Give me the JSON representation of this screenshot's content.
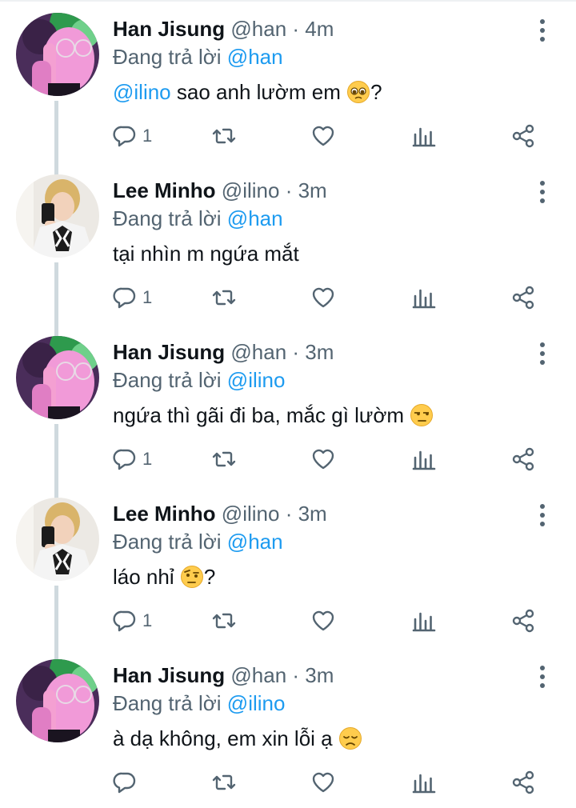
{
  "colors": {
    "accent": "#1d9bf0",
    "secondary_text": "#536471",
    "primary_text": "#0f1419",
    "thread_line": "#cfd9de"
  },
  "tweets": [
    {
      "name": "Han Jisung",
      "handle": "@han",
      "time": "· 4m",
      "replying_prefix": "Đang trả lời",
      "replying_to": "@han",
      "mention": "@ilino",
      "text": " sao anh lườm em ",
      "emoji": "pleading-face",
      "suffix": "?",
      "reply_count": "1",
      "avatar": "han-avatar"
    },
    {
      "name": "Lee Minho",
      "handle": "@ilino",
      "time": "· 3m",
      "replying_prefix": "Đang trả lời",
      "replying_to": "@han",
      "mention": "",
      "text": "tại nhìn m ngứa mắt",
      "emoji": "",
      "suffix": "",
      "reply_count": "1",
      "avatar": "minho-avatar"
    },
    {
      "name": "Han Jisung",
      "handle": "@han",
      "time": "· 3m",
      "replying_prefix": "Đang trả lời",
      "replying_to": "@ilino",
      "mention": "",
      "text": "ngứa thì gãi đi ba, mắc gì lườm ",
      "emoji": "unamused-face",
      "suffix": "",
      "reply_count": "1",
      "avatar": "han-avatar"
    },
    {
      "name": "Lee Minho",
      "handle": "@ilino",
      "time": "· 3m",
      "replying_prefix": "Đang trả lời",
      "replying_to": "@han",
      "mention": "",
      "text": "láo nhỉ ",
      "emoji": "raised-eyebrow-face",
      "suffix": "?",
      "reply_count": "1",
      "avatar": "minho-avatar"
    },
    {
      "name": "Han Jisung",
      "handle": "@han",
      "time": "· 3m",
      "replying_prefix": "Đang trả lời",
      "replying_to": "@ilino",
      "mention": "",
      "text": "à dạ không, em xin lỗi ạ ",
      "emoji": "disappointed-face",
      "suffix": "",
      "reply_count": "",
      "avatar": "han-avatar"
    }
  ],
  "icons": {
    "reply": "reply-icon",
    "retweet": "retweet-icon",
    "like": "heart-icon",
    "views": "views-icon",
    "share": "share-icon",
    "more": "more-icon"
  }
}
